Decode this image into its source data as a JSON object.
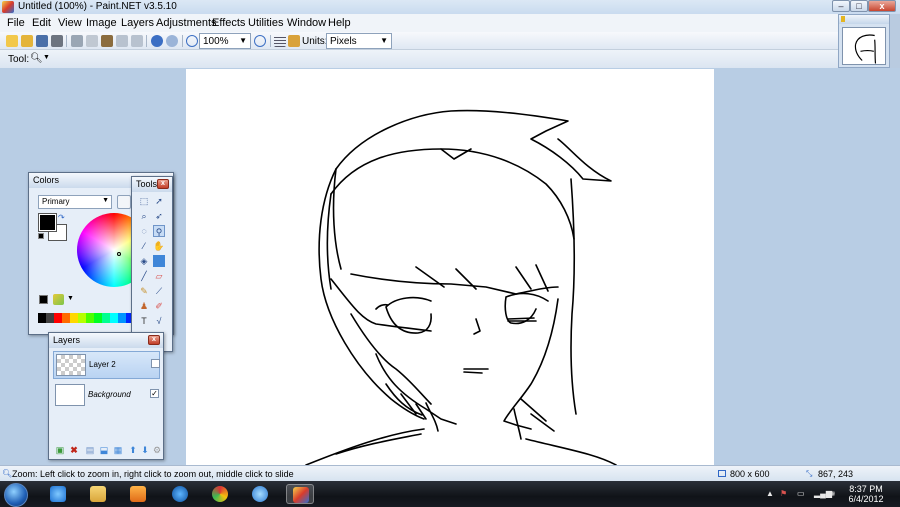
{
  "window": {
    "title": "Untitled (100%) - Paint.NET v3.5.10",
    "min_label": "–",
    "max_label": "□",
    "close_label": "x"
  },
  "menu": [
    "File",
    "Edit",
    "View",
    "Image",
    "Layers",
    "Adjustments",
    "Effects",
    "Utilities",
    "Window",
    "Help"
  ],
  "toolbar": {
    "zoom_value": "100%",
    "units_label": "Units:",
    "units_value": "Pixels"
  },
  "tool_row": {
    "label": "Tool:",
    "current_tool_icon": "magnifier-icon"
  },
  "colors_window": {
    "title": "Colors",
    "mode_value": "Primary",
    "primary_color": "#000000",
    "secondary_color": "#ffffff"
  },
  "tools_window": {
    "title": "Tools",
    "close_label": "x"
  },
  "layers_window": {
    "title": "Layers",
    "close_label": "x",
    "layers": [
      {
        "name": "Layer 2",
        "visible": false,
        "selected": true
      },
      {
        "name": "Background",
        "visible": true,
        "selected": false
      }
    ]
  },
  "status": {
    "hint": "Zoom: Left click to zoom in, right click to zoom out, middle click to slide",
    "image_size": "800 x 600",
    "cursor_pos": "867, 243"
  },
  "taskbar": {
    "time": "8:37 PM",
    "date": "6/4/2012"
  },
  "colors": {
    "workspace": "#b8cde4",
    "canvas": "#ffffff",
    "taskbar": "#101318"
  }
}
